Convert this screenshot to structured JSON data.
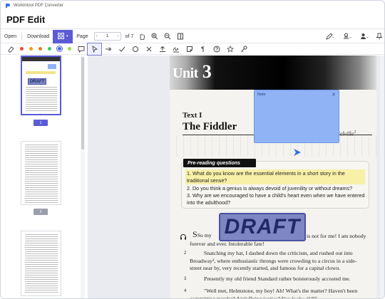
{
  "app": {
    "window_title": "Workintool PDF Converter",
    "page_heading": "PDF Edit"
  },
  "toolbar": {
    "open": "Open",
    "download": "Download",
    "page_label": "Page",
    "current_page": "1",
    "page_total": "of 7"
  },
  "annotation_bar": {
    "colors": [
      "#e74c3c",
      "#f39c12",
      "#e67e22",
      "#2ecc71",
      "#3b6ee8",
      "#a3d94a"
    ],
    "selected_color": "#3b6ee8",
    "tools": [
      "comment-icon",
      "pointer-icon",
      "arrow-icon",
      "check-icon",
      "circle-icon",
      "cross-icon",
      "upload-icon",
      "signature-icon",
      "sticky-note-icon",
      "paragraph-icon",
      "help-icon",
      "star-icon",
      "key-icon"
    ]
  },
  "sidebar": {
    "pages": [
      {
        "label": "1",
        "stamp": "DRAFT"
      },
      {
        "label": "2",
        "stamp": ""
      },
      {
        "label": "",
        "stamp": ""
      }
    ]
  },
  "document": {
    "unit_word": "Unit",
    "unit_number": "3",
    "text_label": "Text I",
    "title": "The Fiddler",
    "author": "Melville",
    "author_mark": "1",
    "prereading_heading": "Pre-reading questions",
    "questions": [
      "1. What do you know are the essential elements in a short story in the traditional sense?",
      "2. Do you think a genius is always devoid of juvenility or without dreams?",
      "3. Why are we encouraged to have a child's heart even when we have entered into the adulthood?"
    ],
    "para1_start": "So my",
    "para1_rest": "is not for me! I am nobody forever and ever. Intolerable fate!",
    "para2_num": "2",
    "para2": "Snatching my hat, I dashed down the criticism, and rushed out into Broadway², where enthusiastic throngs were crowding to a circus in a side-street near by, very recently started, and famous for a capital clown.",
    "para3_num": "3",
    "para3": "Presently my old friend Standard rather boisterously accosted me.",
    "para4_num": "4",
    "para4": "\"Well met, Helmstone, my boy! Ah! What's the matter? Haven't been committing murder? Ain't flying justice? You look wild!\""
  },
  "stamp": {
    "text": "DRAFT"
  },
  "note": {
    "title": "Note"
  }
}
